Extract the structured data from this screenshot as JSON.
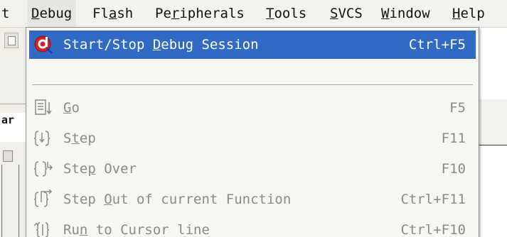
{
  "menubar": {
    "partial_item": "t",
    "items": [
      {
        "pre": "",
        "ul": "D",
        "post": "ebug"
      },
      {
        "pre": "Fl",
        "ul": "a",
        "post": "sh"
      },
      {
        "pre": "Pe",
        "ul": "r",
        "post": "ipherals"
      },
      {
        "pre": "",
        "ul": "T",
        "post": "ools"
      },
      {
        "pre": "",
        "ul": "S",
        "post": "VCS"
      },
      {
        "pre": "",
        "ul": "W",
        "post": "indow"
      },
      {
        "pre": "",
        "ul": "H",
        "post": "elp"
      }
    ]
  },
  "background": {
    "left_label": "ar"
  },
  "dropdown": {
    "items": [
      {
        "pre": "Start/Stop ",
        "ul": "D",
        "post": "ebug Session",
        "shortcut": "Ctrl+F5",
        "icon": "debug-session-icon",
        "state": "selected"
      },
      {
        "pre": "",
        "ul": "G",
        "post": "o",
        "shortcut": "F5",
        "icon": "go-icon",
        "state": "disabled"
      },
      {
        "pre": "S",
        "ul": "t",
        "post": "ep",
        "shortcut": "F11",
        "icon": "step-icon",
        "state": "disabled"
      },
      {
        "pre": "Ste",
        "ul": "p",
        "post": " Over",
        "shortcut": "F10",
        "icon": "step-over-icon",
        "state": "disabled"
      },
      {
        "pre": "Step ",
        "ul": "O",
        "post": "ut of current Function",
        "shortcut": "Ctrl+F11",
        "icon": "step-out-icon",
        "state": "disabled"
      },
      {
        "pre": "Ru",
        "ul": "n",
        "post": " to Cursor line",
        "shortcut": "Ctrl+F10",
        "icon": "run-to-cursor-icon",
        "state": "disabled"
      }
    ]
  },
  "colors": {
    "selection": "#316ac5",
    "menu_bg": "#f7f6f2",
    "disabled_text": "#8a8a86"
  }
}
